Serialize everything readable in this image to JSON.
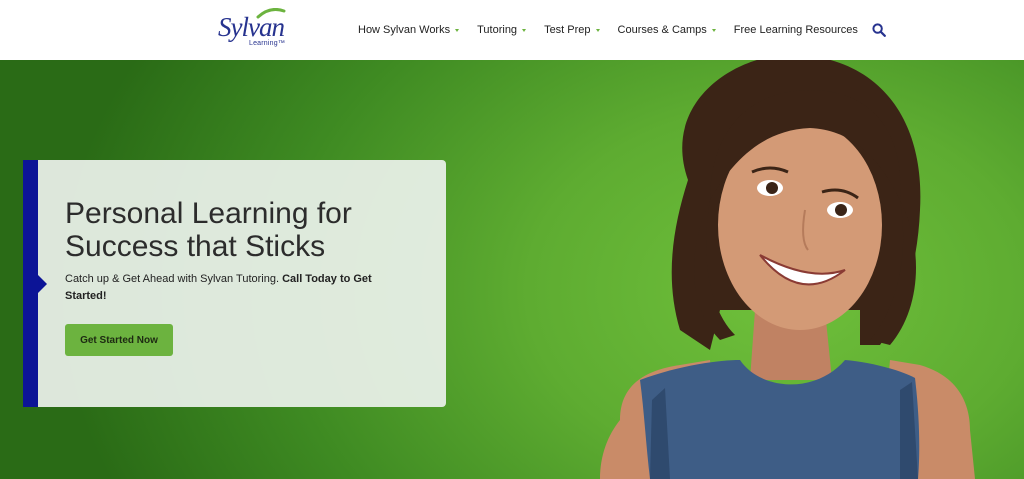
{
  "brand": {
    "name": "Sylvan",
    "tagline": "Learning™",
    "colors": {
      "navy": "#27338f",
      "green": "#6cb33f",
      "accent_bar": "#0c1496"
    }
  },
  "nav": {
    "items": [
      {
        "label": "How Sylvan Works",
        "has_dropdown": true
      },
      {
        "label": "Tutoring",
        "has_dropdown": true
      },
      {
        "label": "Test Prep",
        "has_dropdown": true
      },
      {
        "label": "Courses & Camps",
        "has_dropdown": true
      },
      {
        "label": "Free Learning Resources",
        "has_dropdown": false
      }
    ],
    "search_icon": "search-icon"
  },
  "hero": {
    "headline": "Personal Learning for Success that Sticks",
    "subtext_regular": "Catch up & Get Ahead with Sylvan Tutoring. ",
    "subtext_bold": "Call Today to Get Started!",
    "cta_label": "Get Started Now"
  }
}
